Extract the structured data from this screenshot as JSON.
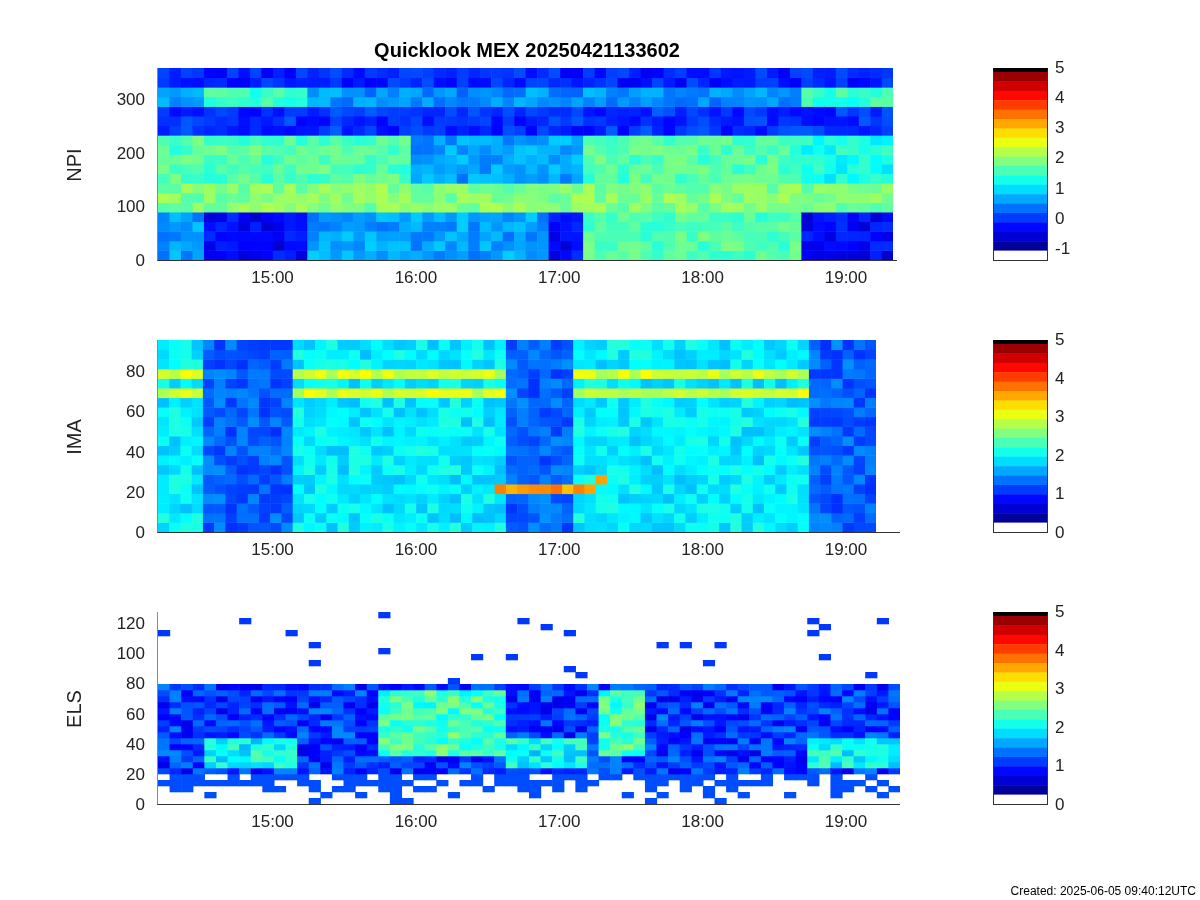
{
  "figure": {
    "title": "Quicklook MEX 20250421133602"
  },
  "panels": [
    {
      "ylabel": "NPI",
      "yticks": [
        "300",
        "200",
        "100",
        "0"
      ],
      "xticks": [
        "15:00",
        "16:00",
        "17:00",
        "18:00",
        "19:00"
      ],
      "colorbar_ticks": [
        "5",
        "4",
        "3",
        "2",
        "1",
        "0",
        "-1"
      ]
    },
    {
      "ylabel": "IMA",
      "yticks": [
        "80",
        "60",
        "40",
        "20",
        "0"
      ],
      "xticks": [
        "15:00",
        "16:00",
        "17:00",
        "18:00",
        "19:00"
      ],
      "colorbar_ticks": [
        "5",
        "4",
        "3",
        "2",
        "1",
        "0"
      ]
    },
    {
      "ylabel": "ELS",
      "yticks": [
        "120",
        "100",
        "80",
        "60",
        "40",
        "20",
        "0"
      ],
      "xticks": [
        "15:00",
        "16:00",
        "17:00",
        "18:00",
        "19:00"
      ],
      "colorbar_ticks": [
        "5",
        "4",
        "3",
        "2",
        "1",
        "0"
      ]
    }
  ],
  "footer": "Created: 2025-06-05 09:40:12UTC"
}
